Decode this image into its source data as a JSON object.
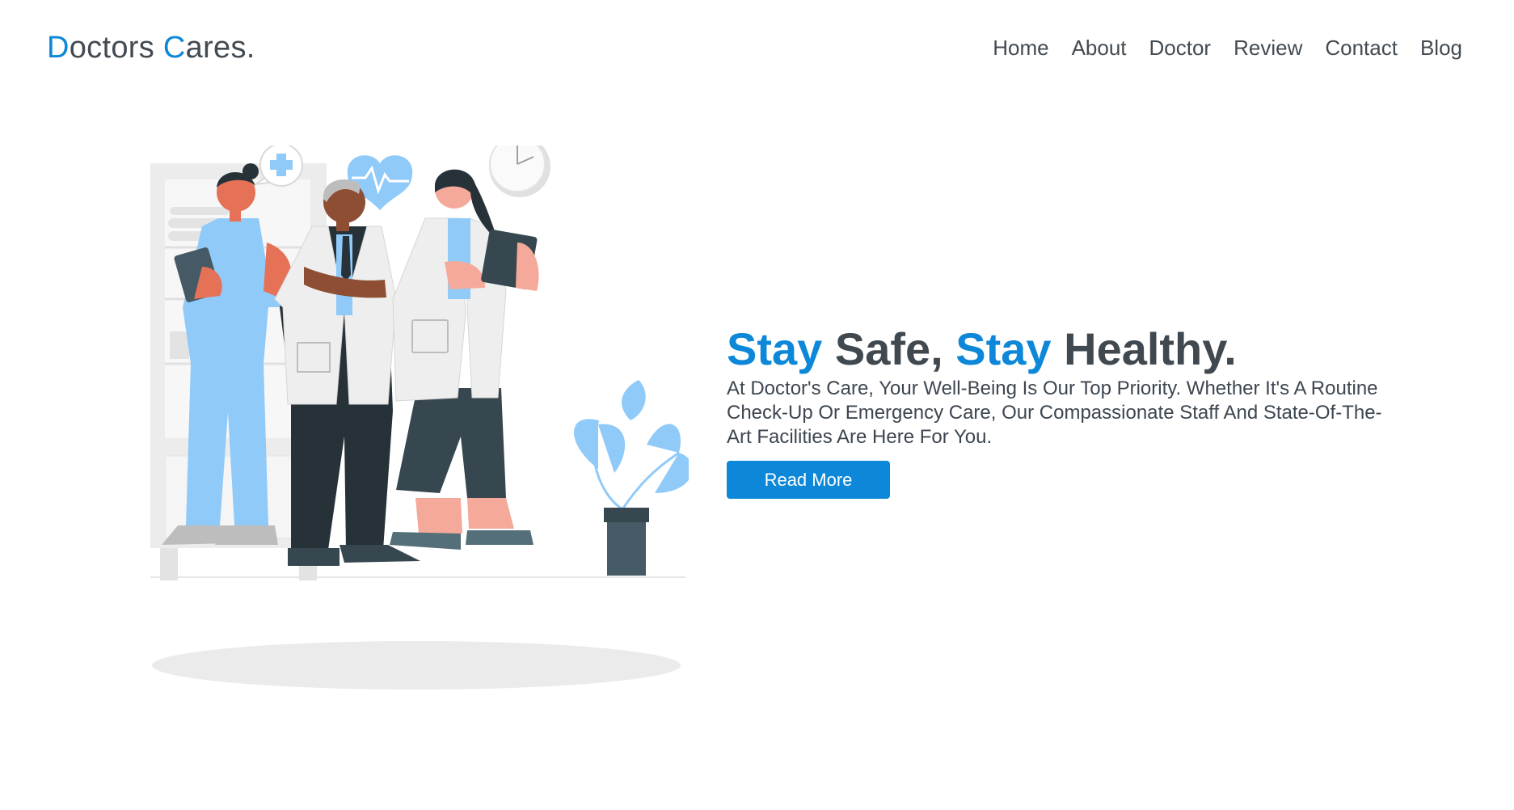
{
  "logo": {
    "part1_accent": "D",
    "part1_rest": "octors ",
    "part2_accent": "C",
    "part2_rest": "ares."
  },
  "nav": {
    "items": [
      {
        "label": "Home"
      },
      {
        "label": "About"
      },
      {
        "label": "Doctor"
      },
      {
        "label": "Review"
      },
      {
        "label": "Contact"
      },
      {
        "label": "Blog"
      }
    ]
  },
  "hero": {
    "title": {
      "w1": "Stay",
      "w2": " Safe, ",
      "w3": "Stay",
      "w4": " Healthy."
    },
    "description": "At Doctor's Care, Your Well-Being Is Our Top Priority. Whether It's A Routine Check-Up Or Emergency Care, Our Compassionate Staff And State-Of-The-Art Facilities Are Here For You.",
    "button_label": "Read More"
  },
  "colors": {
    "accent": "#0d87d8",
    "text": "#414950",
    "light_blue": "#90caf9",
    "dark": "#37474f",
    "skin_coral": "#e57257",
    "skin_pink": "#f5a99a"
  },
  "icons": [
    "heart-pulse-icon",
    "plus-speech-bubble-icon",
    "clock-icon"
  ]
}
